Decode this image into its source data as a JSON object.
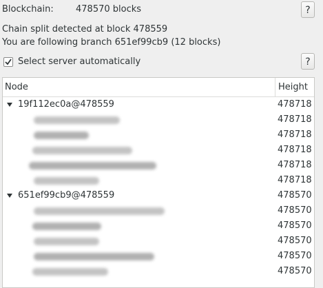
{
  "blockchain": {
    "label": "Blockchain:",
    "value": "478570 blocks"
  },
  "status": {
    "line1": "Chain split detected at block 478559",
    "line2": "You are following branch 651ef99cb9 (12 blocks)"
  },
  "help_button_label": "?",
  "auto_server": {
    "checked": true,
    "label": "Select server automatically"
  },
  "tree": {
    "columns": [
      "Node",
      "Height"
    ],
    "branches": [
      {
        "label": "19f112ec0a@478559",
        "height": "478718",
        "servers": [
          {
            "height": "478718"
          },
          {
            "height": "478718"
          },
          {
            "height": "478718"
          },
          {
            "height": "478718"
          },
          {
            "height": "478718"
          }
        ]
      },
      {
        "label": "651ef99cb9@478559",
        "height": "478570",
        "servers": [
          {
            "height": "478570"
          },
          {
            "height": "478570"
          },
          {
            "height": "478570"
          },
          {
            "height": "478570"
          },
          {
            "height": "478570"
          }
        ]
      }
    ]
  }
}
